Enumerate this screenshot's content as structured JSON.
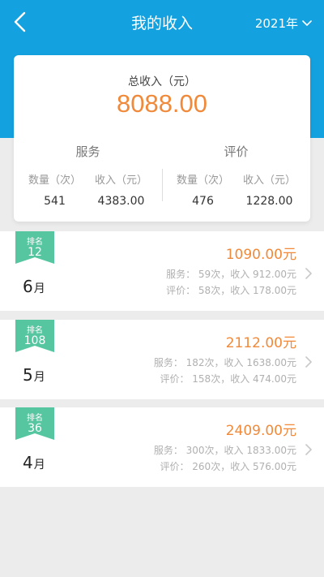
{
  "header": {
    "title": "我的收入",
    "year": "2021年"
  },
  "summary": {
    "total_label": "总收入（元）",
    "total_value": "8088.00",
    "service": {
      "title": "服务",
      "count_label": "数量（次）",
      "income_label": "收入（元）",
      "count": "541",
      "income": "4383.00"
    },
    "review": {
      "title": "评价",
      "count_label": "数量（次）",
      "income_label": "收入（元）",
      "count": "476",
      "income": "1228.00"
    }
  },
  "months": [
    {
      "rank_label": "排名",
      "rank": "12",
      "month": "6",
      "month_unit": "月",
      "amount": "1090.00元",
      "service_line": "服务：   59次，收入 912.00元",
      "review_line": "评价：   58次，收入 178.00元"
    },
    {
      "rank_label": "排名",
      "rank": "108",
      "month": "5",
      "month_unit": "月",
      "amount": "2112.00元",
      "service_line": "服务：   182次，收入 1638.00元",
      "review_line": "评价：   158次，收入 474.00元"
    },
    {
      "rank_label": "排名",
      "rank": "36",
      "month": "4",
      "month_unit": "月",
      "amount": "2409.00元",
      "service_line": "服务：   300次，收入 1833.00元",
      "review_line": "评价：   260次，收入 576.00元"
    }
  ],
  "colors": {
    "primary": "#14a1df",
    "accent": "#f08a3a",
    "badge": "#56c6a0"
  },
  "icons": {
    "back": "chevron-left-icon",
    "year_dropdown": "chevron-down-icon",
    "row": "chevron-right-icon",
    "rank_badge": "ribbon-badge-icon"
  }
}
